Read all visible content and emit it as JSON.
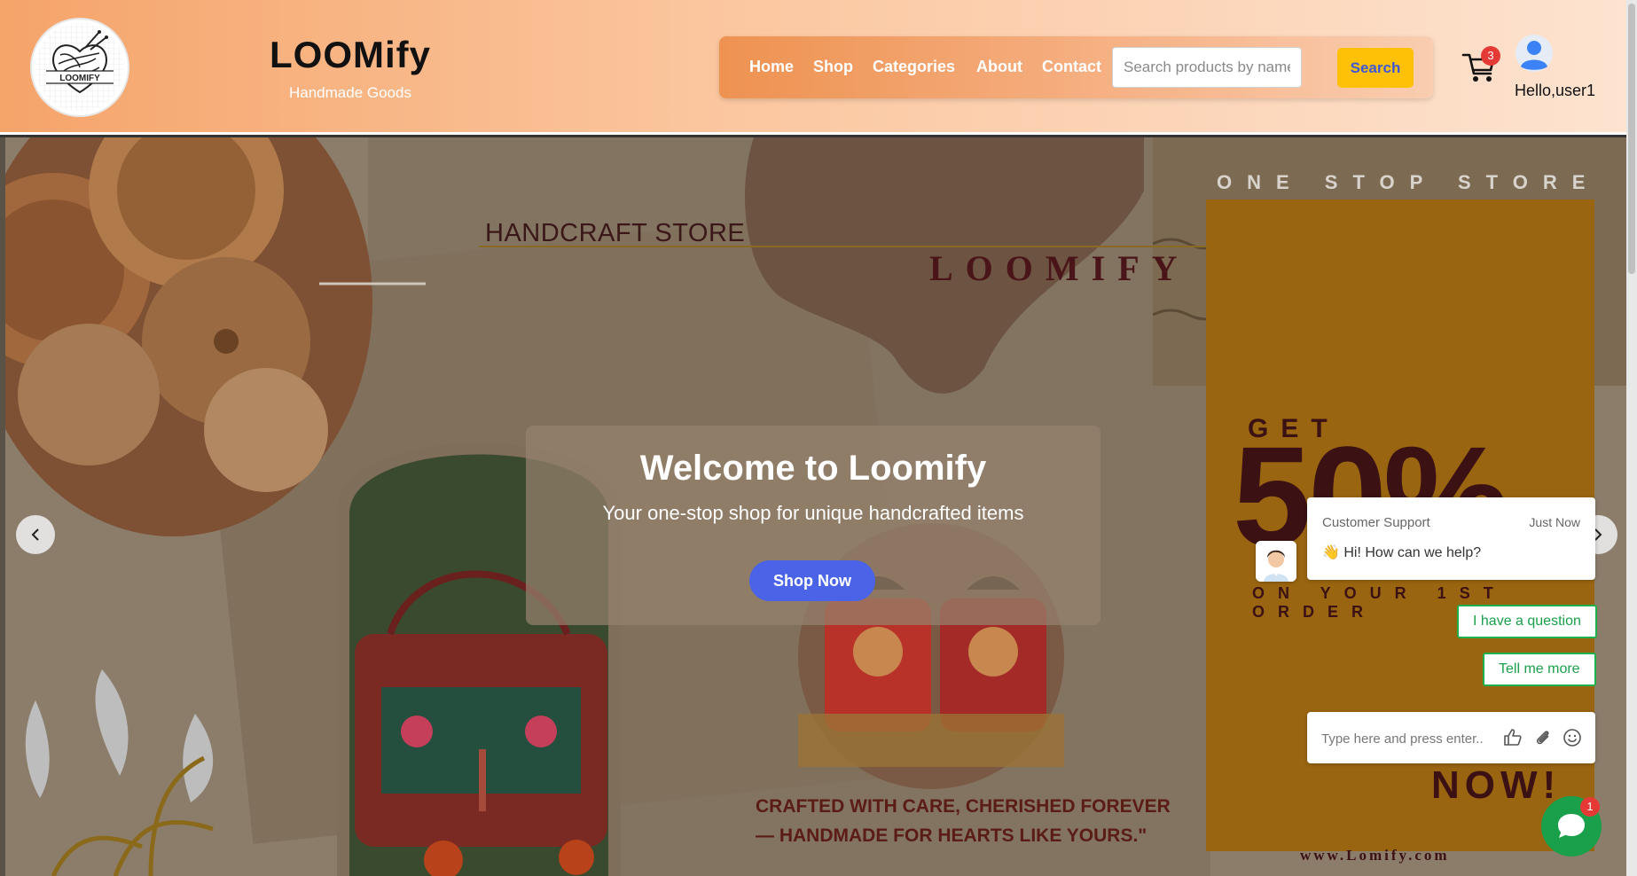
{
  "brand": {
    "logo_text": "LOOMIFY",
    "title": "LOOMify",
    "subtitle": "Handmade Goods"
  },
  "nav": {
    "links": [
      "Home",
      "Shop",
      "Categories",
      "About",
      "Contact"
    ],
    "search_placeholder": "Search products by name, c",
    "search_button": "Search"
  },
  "user": {
    "cart_count": "3",
    "greeting": "Hello,user1"
  },
  "hero": {
    "welcome_title": "Welcome to Loomify",
    "welcome_subtitle": "Your one-stop shop for unique handcrafted items",
    "cta": "Shop Now",
    "poster": {
      "store_label": "HANDCRAFT STORE",
      "brand_word": "LOOMIFY",
      "tagline_top": "ONE STOP STORE",
      "get": "GET",
      "discount": "50%",
      "order_line": "ON YOUR 1ST ORDER",
      "now": "NOW!",
      "website": "www.Lomify.com",
      "quote_line1": "CRAFTED WITH CARE, CHERISHED FOREVER",
      "quote_line2": "— HANDMADE FOR HEARTS LIKE YOURS.\""
    }
  },
  "chat": {
    "sender": "Customer Support",
    "time": "Just Now",
    "message": "👋 Hi! How can we help?",
    "options": [
      "I have a question",
      "Tell me more"
    ],
    "input_placeholder": "Type here and press enter..",
    "unread_count": "1"
  },
  "colors": {
    "accent_orange": "#ee9251",
    "search_yellow": "#ffc107",
    "primary_blue": "#4a63e7",
    "chat_green": "#1aa04a",
    "poster_mustard": "#9a6510",
    "poster_maroon": "#3b1114"
  }
}
